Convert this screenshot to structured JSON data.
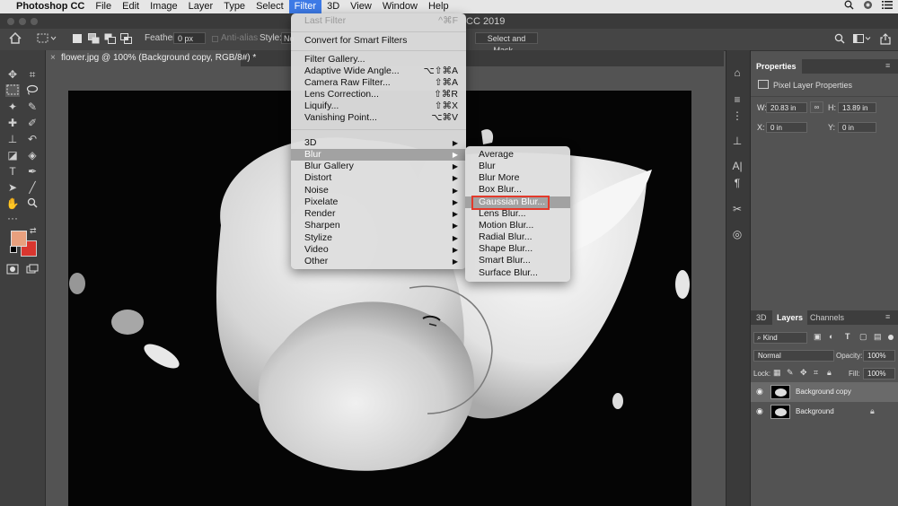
{
  "menubar": {
    "apple": "",
    "app_name": "Photoshop CC",
    "items": [
      "File",
      "Edit",
      "Image",
      "Layer",
      "Type",
      "Select",
      "Filter",
      "3D",
      "View",
      "Window",
      "Help"
    ],
    "active_item": "Filter"
  },
  "title_bar": {
    "title_fragment": "CC 2019"
  },
  "options_bar": {
    "feather_label": "Feather:",
    "feather_value": "0 px",
    "antialias_label": "Anti-alias",
    "style_label": "Style:",
    "style_value": "No",
    "select_mask": "Select and Mask..."
  },
  "document_tab": {
    "title": "flower.jpg @ 100% (Background copy, RGB/8#) *",
    "close": "×"
  },
  "colors": {
    "foreground": "#e8a07e",
    "background": "#d9362f",
    "accent": "#3d7ae6",
    "highlight_box": "#e33a2b"
  },
  "filter_menu": {
    "items": [
      {
        "label": "Last Filter",
        "shortcut": "^⌘F",
        "disabled": true
      },
      {
        "label": "Convert for Smart Filters"
      },
      {
        "label": "Filter Gallery..."
      },
      {
        "label": "Adaptive Wide Angle...",
        "shortcut": "⌥⇧⌘A"
      },
      {
        "label": "Camera Raw Filter...",
        "shortcut": "⇧⌘A"
      },
      {
        "label": "Lens Correction...",
        "shortcut": "⇧⌘R"
      },
      {
        "label": "Liquify...",
        "shortcut": "⇧⌘X"
      },
      {
        "label": "Vanishing Point...",
        "shortcut": "⌥⌘V"
      },
      {
        "label": "3D"
      },
      {
        "label": "Blur"
      },
      {
        "label": "Blur Gallery"
      },
      {
        "label": "Distort"
      },
      {
        "label": "Noise"
      },
      {
        "label": "Pixelate"
      },
      {
        "label": "Render"
      },
      {
        "label": "Sharpen"
      },
      {
        "label": "Stylize"
      },
      {
        "label": "Video"
      },
      {
        "label": "Other"
      }
    ],
    "submenu_arrow": "▶",
    "highlighted": "Blur"
  },
  "blur_submenu": {
    "items": [
      "Average",
      "Blur",
      "Blur More",
      "Box Blur...",
      "Gaussian Blur...",
      "Lens Blur...",
      "Motion Blur...",
      "Radial Blur...",
      "Shape Blur...",
      "Smart Blur...",
      "Surface Blur..."
    ],
    "highlighted": "Gaussian Blur..."
  },
  "properties_panel": {
    "tab": "Properties",
    "heading": "Pixel Layer Properties",
    "w_label": "W:",
    "w_value": "20.83 in",
    "h_label": "H:",
    "h_value": "13.89 in",
    "x_label": "X:",
    "x_value": "0 in",
    "y_label": "Y:",
    "y_value": "0 in"
  },
  "layers_panel": {
    "tabs": [
      "3D",
      "Layers",
      "Channels"
    ],
    "active_tab": "Layers",
    "kind_label": "Kind",
    "blend_mode": "Normal",
    "opacity_label": "Opacity:",
    "opacity_value": "100%",
    "lock_label": "Lock:",
    "fill_label": "Fill:",
    "fill_value": "100%",
    "layers": [
      {
        "name": "Background copy",
        "selected": true,
        "locked": false
      },
      {
        "name": "Background",
        "selected": false,
        "locked": true
      }
    ]
  }
}
